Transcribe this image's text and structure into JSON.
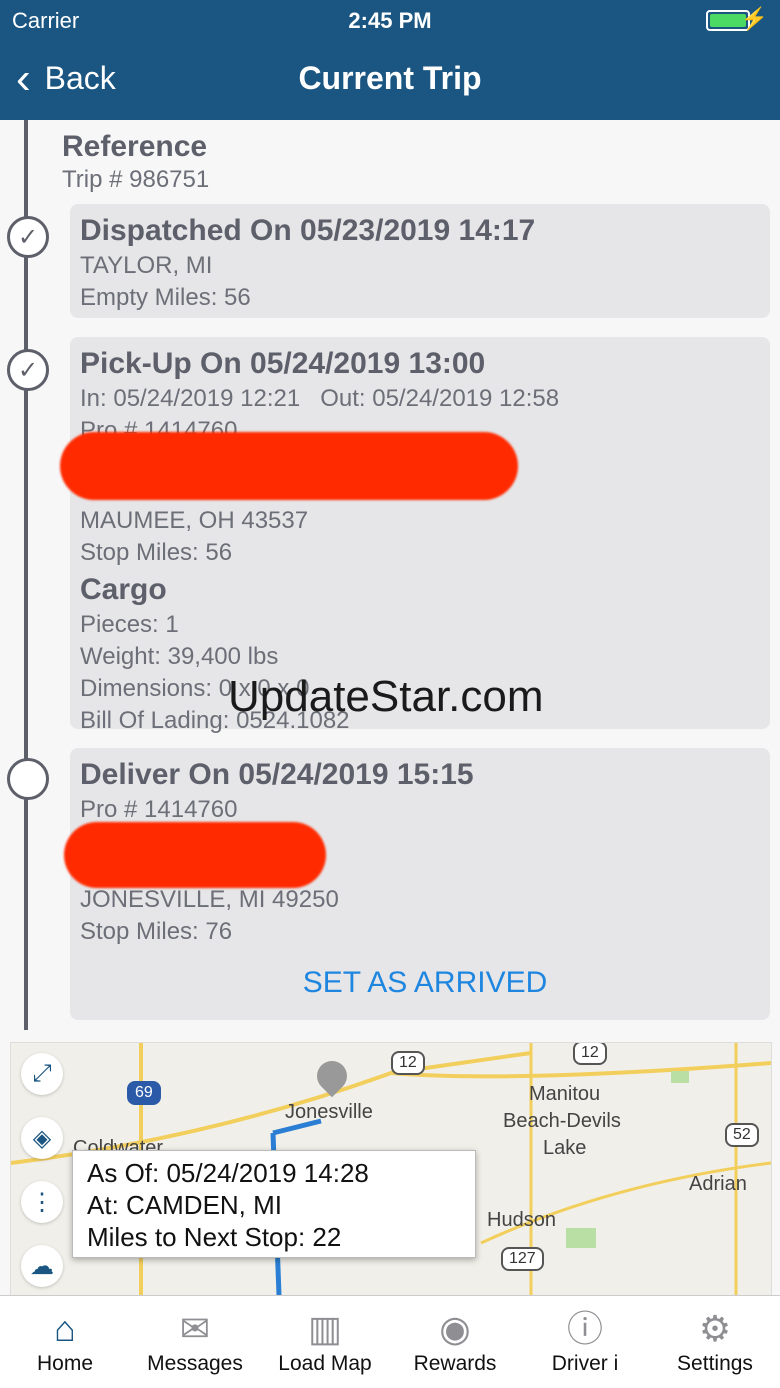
{
  "status_bar": {
    "carrier": "Carrier",
    "time": "2:45 PM"
  },
  "nav": {
    "back_label": "Back",
    "title": "Current Trip"
  },
  "reference": {
    "title": "Reference",
    "trip": "Trip # 986751"
  },
  "stops": {
    "dispatched": {
      "heading": "Dispatched On 05/23/2019 14:17",
      "location": "TAYLOR, MI",
      "miles": "Empty Miles: 56"
    },
    "pickup": {
      "heading": "Pick-Up On 05/24/2019 13:00",
      "in": "In: 05/24/2019 12:21",
      "out": "Out: 05/24/2019 12:58",
      "pro": "Pro # 1414760",
      "location": "MAUMEE, OH 43537",
      "miles": "Stop Miles: 56",
      "cargo_title": "Cargo",
      "pieces": "Pieces: 1",
      "weight": "Weight: 39,400 lbs",
      "dimensions": "Dimensions: 0 x 0 x 0",
      "bol": "Bill Of Lading: 0524.1082"
    },
    "deliver": {
      "heading": "Deliver On 05/24/2019 15:15",
      "pro": "Pro # 1414760",
      "location": "JONESVILLE, MI 49250",
      "miles": "Stop Miles: 76",
      "action": "SET AS ARRIVED"
    }
  },
  "watermark": "UpdateStar.com",
  "map": {
    "labels": {
      "jonesville": "Jonesville",
      "coldwater": "Coldwater",
      "manitou": "Manitou",
      "beach": "Beach-Devils",
      "lake": "Lake",
      "adrian": "Adrian",
      "hudson": "Hudson"
    },
    "routes": {
      "i69": "69",
      "r12a": "12",
      "r12b": "12",
      "r52": "52",
      "r127": "127"
    },
    "popup": {
      "as_of": "As Of: 05/24/2019 14:28",
      "at": "At: CAMDEN, MI",
      "miles": "Miles to Next Stop: 22"
    }
  },
  "tabs": [
    {
      "label": "Home",
      "icon": "home-icon"
    },
    {
      "label": "Messages",
      "icon": "envelope-icon"
    },
    {
      "label": "Load Map",
      "icon": "map-icon"
    },
    {
      "label": "Rewards",
      "icon": "rewards-icon"
    },
    {
      "label": "Driver i",
      "icon": "info-icon"
    },
    {
      "label": "Settings",
      "icon": "gear-icon"
    }
  ]
}
